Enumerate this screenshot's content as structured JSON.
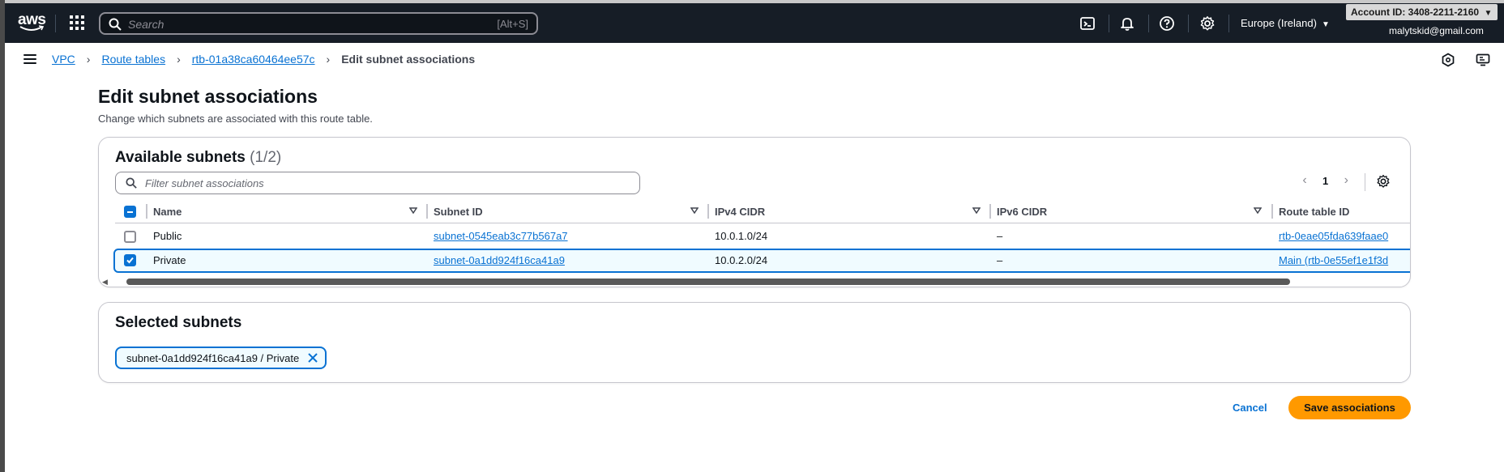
{
  "topnav": {
    "logo_text": "aws",
    "search_placeholder": "Search",
    "search_shortcut": "[Alt+S]",
    "region": "Europe (Ireland)",
    "account_id": "Account ID: 3408-2211-2160",
    "email": "malytskid@gmail.com"
  },
  "breadcrumb": {
    "items": [
      "VPC",
      "Route tables",
      "rtb-01a38ca60464ee57c"
    ],
    "current": "Edit subnet associations"
  },
  "page": {
    "title": "Edit subnet associations",
    "description": "Change which subnets are associated with this route table."
  },
  "available": {
    "title": "Available subnets",
    "count": "(1/2)",
    "filter_placeholder": "Filter subnet associations",
    "page_number": "1",
    "columns": [
      "Name",
      "Subnet ID",
      "IPv4 CIDR",
      "IPv6 CIDR",
      "Route table ID"
    ],
    "rows": [
      {
        "checked": false,
        "name": "Public",
        "subnet_id": "subnet-0545eab3c77b567a7",
        "ipv4": "10.0.1.0/24",
        "ipv6": "–",
        "route_table": "rtb-0eae05fda639faae0"
      },
      {
        "checked": true,
        "name": "Private",
        "subnet_id": "subnet-0a1dd924f16ca41a9",
        "ipv4": "10.0.2.0/24",
        "ipv6": "–",
        "route_table": "Main (rtb-0e55ef1e1f3d"
      }
    ]
  },
  "selected": {
    "title": "Selected subnets",
    "tokens": [
      "subnet-0a1dd924f16ca41a9 / Private"
    ]
  },
  "actions": {
    "cancel": "Cancel",
    "save": "Save associations"
  },
  "colors": {
    "nav_bg": "#161d26",
    "link": "#0972d3",
    "primary_button": "#ff9900"
  }
}
